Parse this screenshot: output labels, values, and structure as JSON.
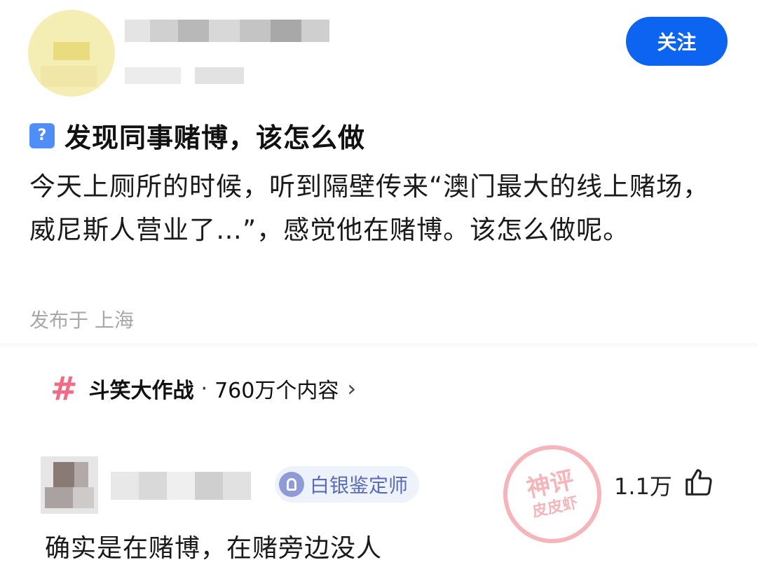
{
  "post": {
    "follow_label": "关注",
    "question_icon": "?",
    "title": "发现同事赌博，该怎么做",
    "body": "今天上厕所的时候，听到隔壁传来“澳门最大的线上赌场，威尼斯人营业了…”，感觉他在赌博。该怎么做呢。",
    "location": "发布于 上海"
  },
  "topic": {
    "icon": "#",
    "name": "斗笑大作战",
    "separator": "·",
    "count": "760万个内容",
    "chevron": "›"
  },
  "comment": {
    "badge_label": "白银鉴定师",
    "likes": "1.1万",
    "text": "确实是在赌博，在赌旁边没人"
  },
  "watermark": {
    "line1": "神评",
    "line2": "皮皮虾"
  },
  "colors": {
    "accent": "#0d64f0",
    "topic_hash": "#f06b86",
    "badge_bg": "#eef2fb",
    "badge_text": "#5a6bb8",
    "watermark": "#ec7882"
  },
  "icons": {
    "question": "question-mark-icon",
    "topic": "hashtag-icon",
    "chevron": "chevron-right-icon",
    "badge": "silver-appraiser-badge-icon",
    "like": "thumbs-up-icon"
  }
}
